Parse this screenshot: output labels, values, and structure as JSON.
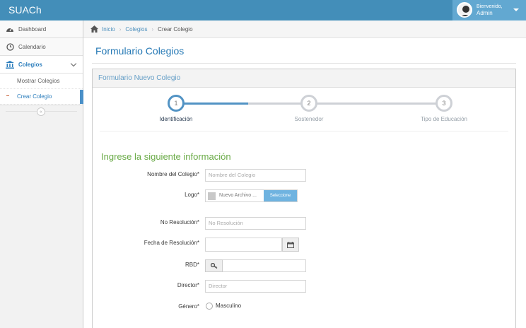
{
  "app": {
    "brand": "SUACh"
  },
  "user": {
    "welcome": "Bienvenido,",
    "name": "Admin"
  },
  "sidebar": {
    "items": [
      {
        "label": "Dashboard"
      },
      {
        "label": "Calendario"
      },
      {
        "label": "Colegios"
      }
    ],
    "submenu": [
      {
        "label": "Mostrar Colegios"
      },
      {
        "label": "Crear Colegio"
      }
    ]
  },
  "breadcrumb": {
    "home": "Inicio",
    "section": "Colegios",
    "current": "Crear Colegio"
  },
  "page": {
    "title": "Formulario Colegios"
  },
  "widget": {
    "title": "Formulario Nuevo Colegio"
  },
  "steps": [
    {
      "number": "1",
      "title": "Identificación"
    },
    {
      "number": "2",
      "title": "Sostenedor"
    },
    {
      "number": "3",
      "title": "Tipo de Educación"
    }
  ],
  "form": {
    "heading": "Ingrese la siguiente información",
    "nombre": {
      "label": "Nombre del Colegio*",
      "placeholder": "Nombre del Colegio"
    },
    "logo": {
      "label": "Logo*",
      "file_text": "Nuevo Archivo ...",
      "button": "Seleccione"
    },
    "resolucion": {
      "label": "No Resolución*",
      "placeholder": "No Resolución"
    },
    "fecha": {
      "label": "Fecha de Resolución*"
    },
    "rbd": {
      "label": "RBD*"
    },
    "director": {
      "label": "Director*",
      "placeholder": "Director"
    },
    "genero": {
      "label": "Género*",
      "option": "Masculino"
    }
  }
}
